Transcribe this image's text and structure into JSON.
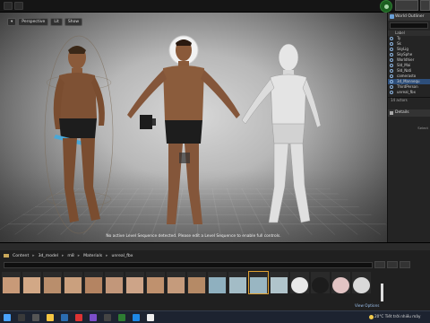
{
  "viewport": {
    "toolbar": {
      "perspective": "Perspective",
      "lit": "Lit",
      "show": "Show"
    },
    "status_message": "No active Level Sequence detected. Please edit a Level Sequence to enable full controls."
  },
  "world_outliner": {
    "tab_label": "World Outliner",
    "column_label": "Label",
    "rows": [
      "Ty",
      "Sk",
      "SkyLig",
      "SkySphe",
      "Worldhier",
      "Sld_Mai",
      "Sld_Nati",
      "camerasto",
      "3d_Mannequ",
      "ThirdPerson",
      "unreal_fbx"
    ],
    "actor_count": "14 actors",
    "details_label": "Details",
    "details_hint": "Select"
  },
  "content_browser": {
    "breadcrumb": [
      "Content",
      "3d_model",
      "m8",
      "Materials",
      "unreal_fbx"
    ],
    "view_options": "View Options",
    "thumbnails": [
      {
        "label": "",
        "color": "#c89a78"
      },
      {
        "label": "",
        "color": "#d2a886"
      },
      {
        "label": "",
        "color": "#b98e6c"
      },
      {
        "label": "",
        "color": "#caa07e"
      },
      {
        "label": "",
        "color": "#b48462"
      },
      {
        "label": "",
        "color": "#c2977a"
      },
      {
        "label": "",
        "color": "#cda488"
      },
      {
        "label": "",
        "color": "#bf916e"
      },
      {
        "label": "",
        "color": "#c59b7c"
      },
      {
        "label": "",
        "color": "#b58a66"
      },
      {
        "label": "",
        "color": "#8fb0bf"
      },
      {
        "label": "",
        "color": "#a3bcc6"
      },
      {
        "label": "",
        "color": "#99b6c2"
      },
      {
        "label": "",
        "color": "#b0c4cb"
      },
      {
        "label": "",
        "color": "#e8e8e8"
      },
      {
        "label": "",
        "color": "#1c1c1c"
      },
      {
        "label": "",
        "color": "#e2c4c4"
      },
      {
        "label": "",
        "color": "#d9d9d9"
      }
    ]
  },
  "taskbar": {
    "weather_temp": "20°C",
    "weather_text": "Tiết trời nhiều mây"
  },
  "colors": {
    "accent_blue": "#2d4e7a",
    "selection_orange": "#e0a030"
  }
}
